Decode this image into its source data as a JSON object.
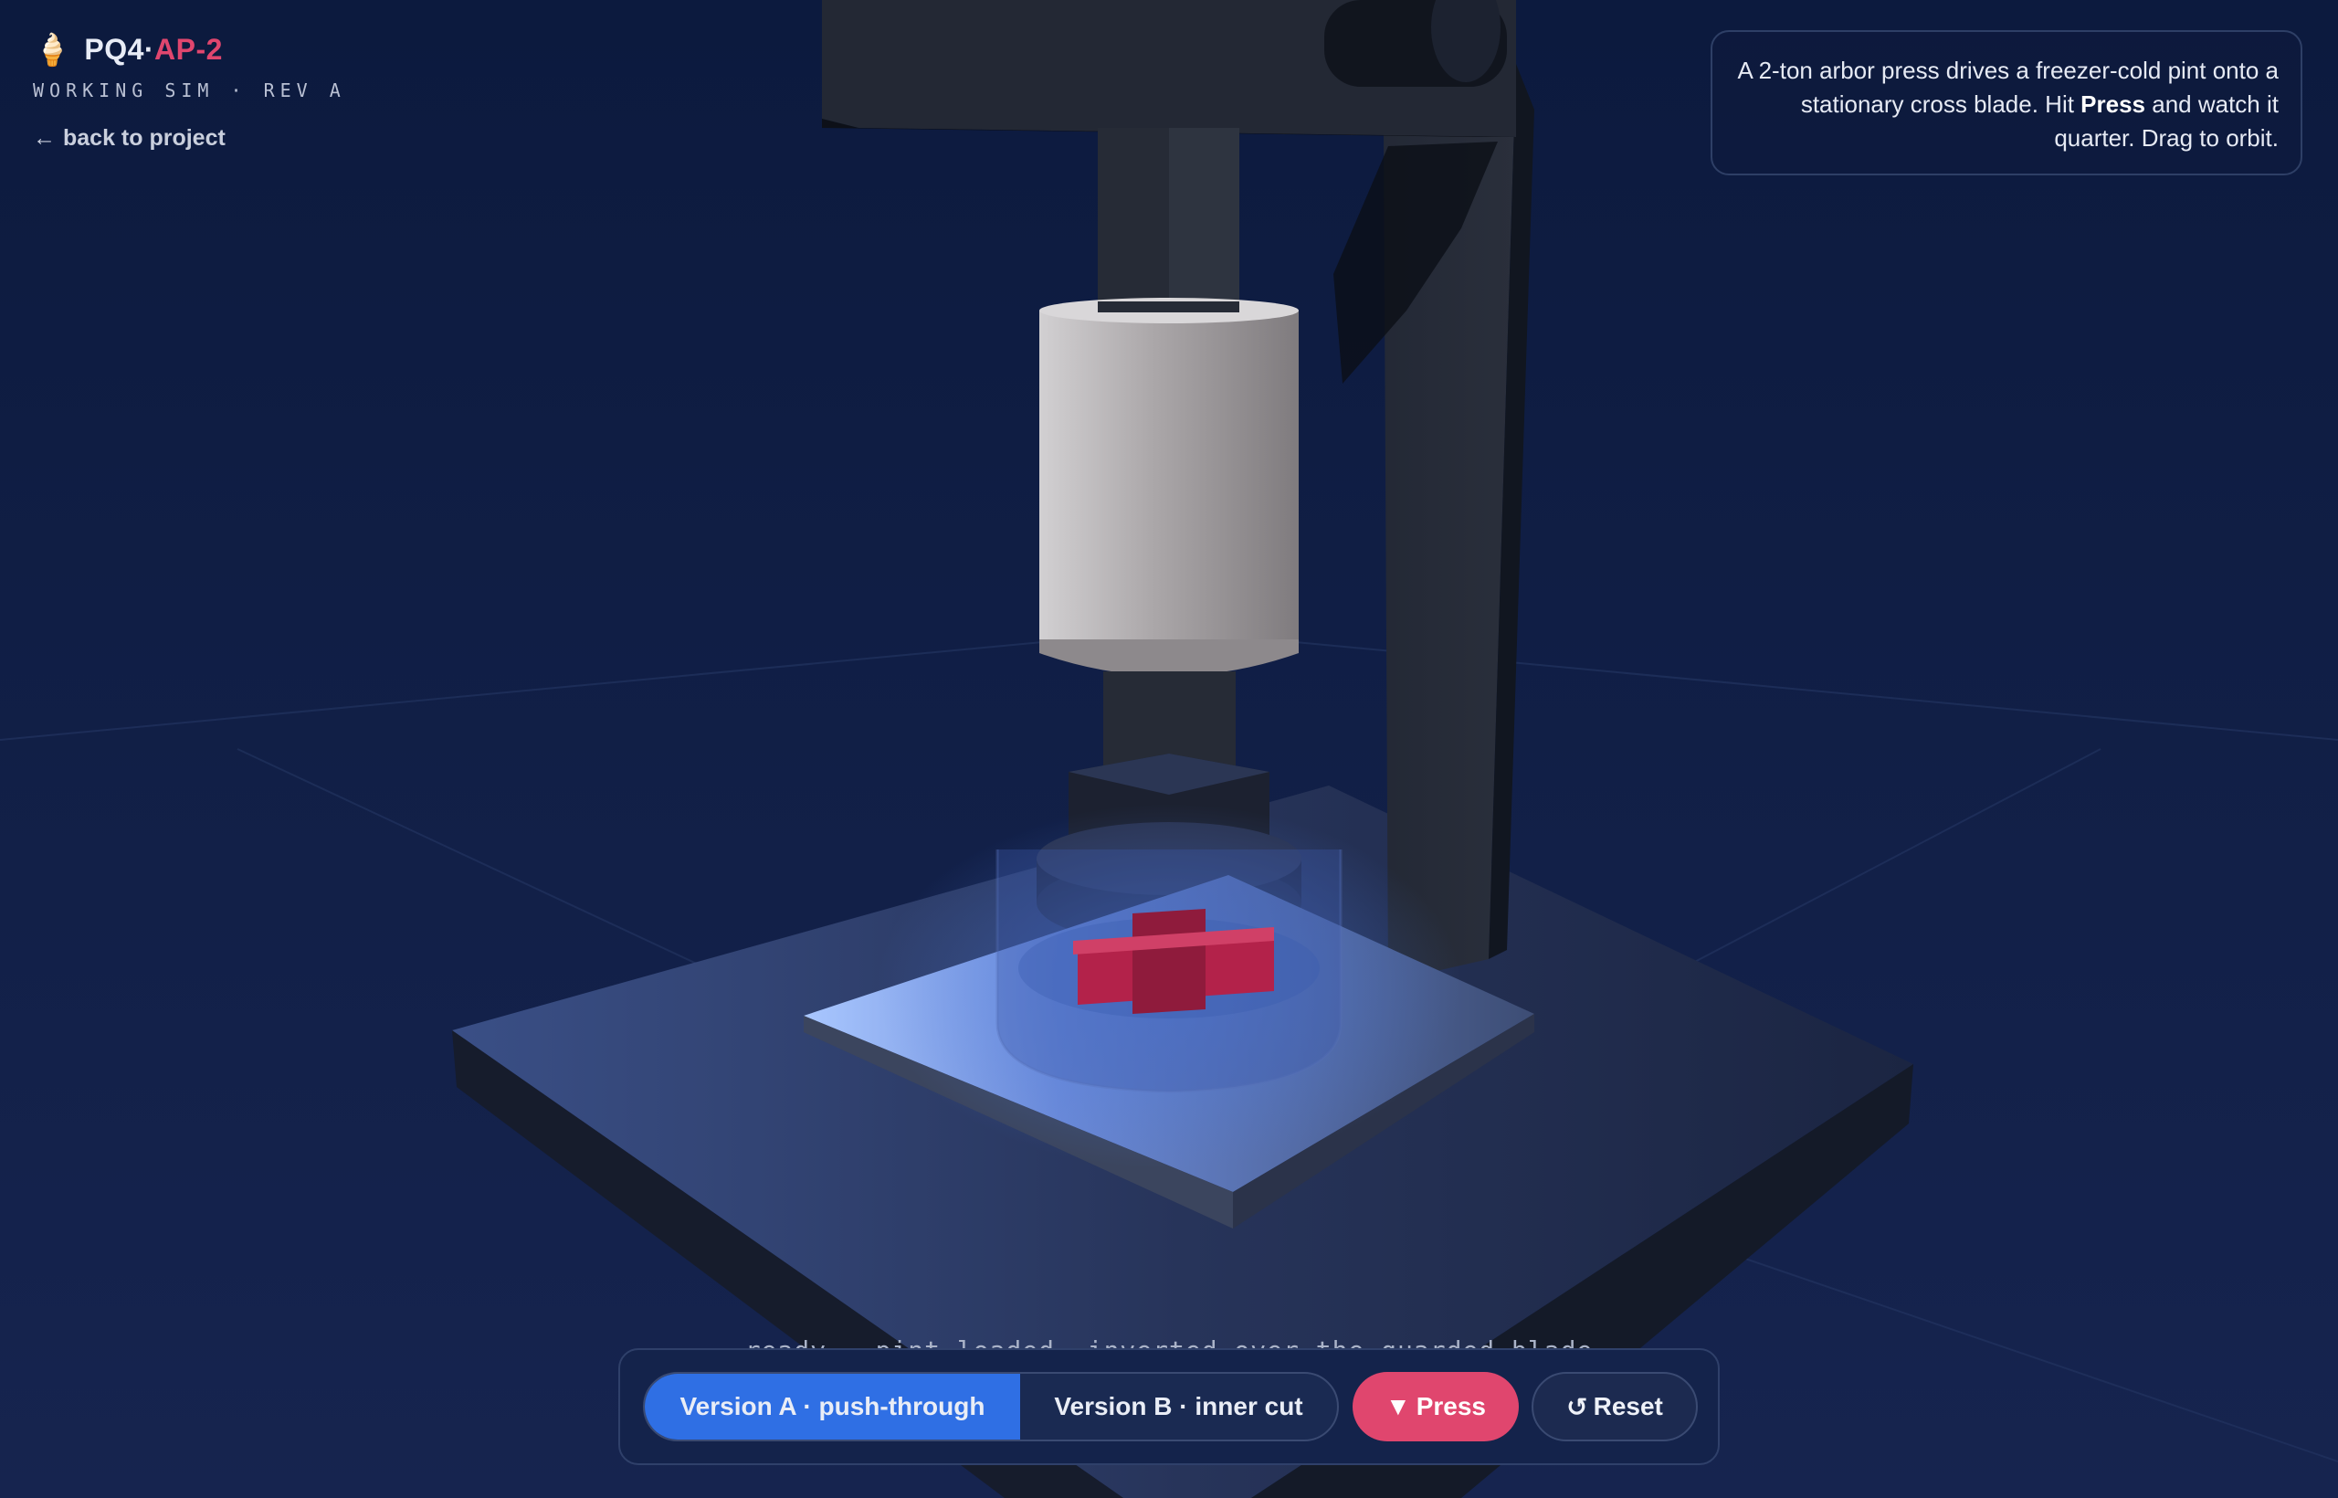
{
  "brand": {
    "icon": "ice-cream-icon",
    "name_main": "PQ4·",
    "name_accent": "AP-2",
    "subtitle": "WORKING SIM · REV A",
    "back_label": "back to project",
    "back_icon": "arrow-left-icon"
  },
  "info": {
    "text_before": "A 2-ton arbor press drives a freezer-cold pint onto a stationary cross blade. Hit ",
    "text_bold": "Press",
    "text_after": " and watch it quarter. Drag to orbit."
  },
  "status_text": "ready · pint loaded, inverted over the guarded blade",
  "toolbar": {
    "version_a_label": "Version A · push-through",
    "version_b_label": "Version B · inner cut",
    "selected_version": "A",
    "press_icon": "triangle-down-icon",
    "press_label": "Press",
    "reset_icon": "rotate-ccw-icon",
    "reset_label": "Reset"
  },
  "colors": {
    "background": "#0e1b3f",
    "accent_pink": "#e0466e",
    "accent_blue": "#2f6fe4",
    "blade_red": "#b3224a"
  }
}
